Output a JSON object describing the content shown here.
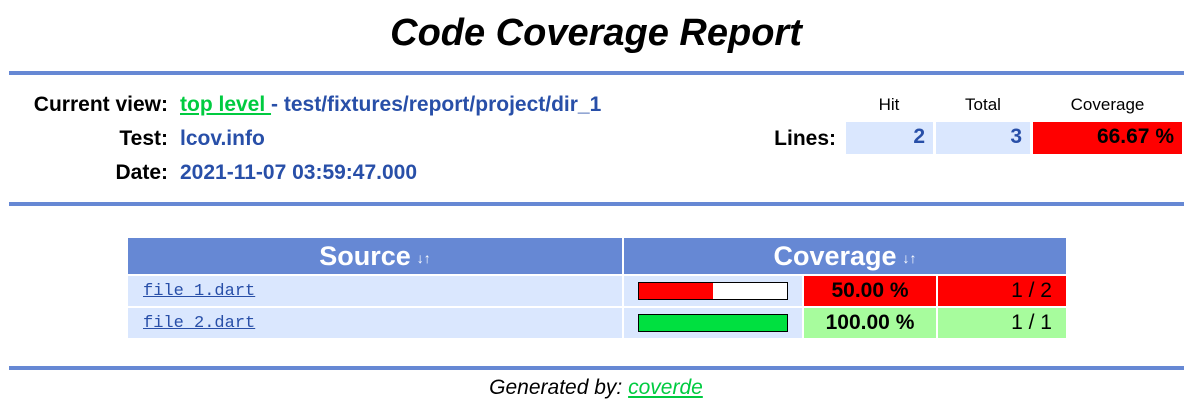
{
  "title": "Code Coverage Report",
  "header": {
    "current_view_label": "Current view:",
    "top_level_link": "top level ",
    "path_text": "- test/fixtures/report/project/dir_1",
    "test_label": "Test:",
    "test_value": "lcov.info",
    "date_label": "Date:",
    "date_value": "2021-11-07 03:59:47.000"
  },
  "summary": {
    "col_hit": "Hit",
    "col_total": "Total",
    "col_coverage": "Coverage",
    "row_label": "Lines:",
    "hit": "2",
    "total": "3",
    "coverage": "66.67 %"
  },
  "table": {
    "source_header": "Source",
    "coverage_header": "Coverage",
    "sort_icon": "↓↑",
    "rows": [
      {
        "file": "file_1.dart",
        "percent": "50.00 %",
        "ratio": "1 / 2",
        "fill": 0.5,
        "bar_color": "#ff0000",
        "cell_color": "#ff0000"
      },
      {
        "file": "file_2.dart",
        "percent": "100.00 %",
        "ratio": "1 / 1",
        "fill": 1.0,
        "bar_color": "#00e040",
        "cell_color": "#a7fc9d"
      }
    ]
  },
  "footer": {
    "prefix": "Generated by: ",
    "link": "coverde"
  },
  "colors": {
    "rule": "#6688d4",
    "value_blue": "#284fa8",
    "link_green": "#00cb40",
    "row_bg": "#dae7fe",
    "low_red": "#ff0000",
    "high_green": "#a7fc9d"
  }
}
